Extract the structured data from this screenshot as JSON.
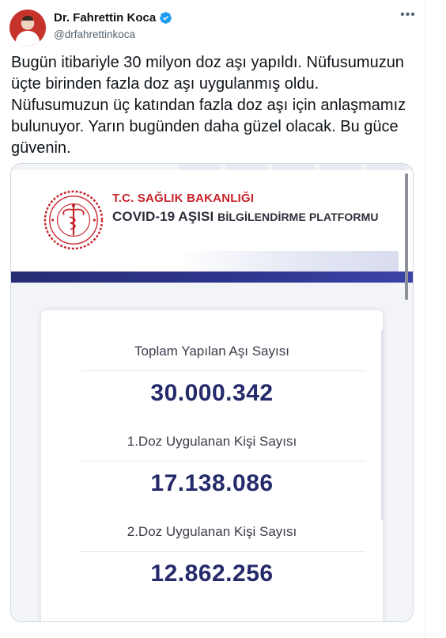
{
  "tweet": {
    "display_name": "Dr. Fahrettin Koca",
    "handle": "@drfahrettinkoca",
    "more_icon": "more-horizontal-icon",
    "verified_icon": "verified-badge-icon",
    "text": "Bugün itibariyle 30 milyon doz aşı yapıldı. Nüfusumuzun üçte birinden fazla doz aşı uygulanmış oldu. Nüfusumuzun üç katından fazla doz aşı için anlaşmamız bulunuyor. Yarın bugünden daha güzel olacak. Bu güce güvenin."
  },
  "media": {
    "ministry": "T.C. SAĞLIK BAKANLIĞI",
    "platform_main": "COVID-19 AŞISI",
    "platform_rest": "BİLGİLENDİRME PLATFORMU",
    "stats": [
      {
        "label": "Toplam Yapılan Aşı Sayısı",
        "value": "30.000.342"
      },
      {
        "label": "1.Doz Uygulanan Kişi Sayısı",
        "value": "17.138.086"
      },
      {
        "label": "2.Doz Uygulanan Kişi Sayısı",
        "value": "12.862.256"
      }
    ]
  },
  "colors": {
    "verified": "#1d9bf0",
    "ministry_red": "#c8232c",
    "stat_navy": "#252a6b",
    "band_navy": "#2f3690"
  }
}
